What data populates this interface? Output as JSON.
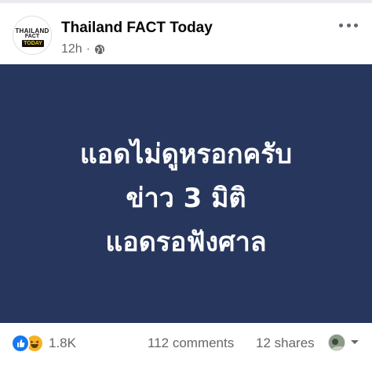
{
  "page": {
    "name": "Thailand FACT Today",
    "time": "12h",
    "separator": "·",
    "privacy_icon": "globe-icon",
    "more_icon": "more-options-icon"
  },
  "avatar": {
    "line1": "THAILAND",
    "line2": "FACT",
    "line3": "TODAY"
  },
  "post_image": {
    "background": "#27365d",
    "lines": [
      "แอดไม่ดูหรอกครับ",
      "ข่าว 3 มิติ",
      "แอดรอฟังศาล"
    ]
  },
  "footer": {
    "reaction_icons": [
      "like-icon",
      "haha-icon"
    ],
    "reaction_count": "1.8K",
    "comments": "112 comments",
    "shares": "12 shares",
    "colors": {
      "like": "#1877f2",
      "haha": "#f7b125",
      "meta_text": "#65676b"
    }
  }
}
